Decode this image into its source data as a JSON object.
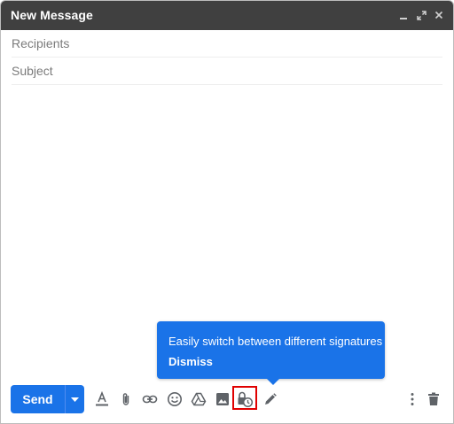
{
  "window": {
    "title": "New Message",
    "controls": {
      "minimize": "minimize-icon",
      "popout": "expand-icon",
      "close": "close-icon"
    }
  },
  "fields": {
    "recipients_placeholder": "Recipients",
    "recipients_value": "",
    "subject_placeholder": "Subject",
    "subject_value": ""
  },
  "toolbar": {
    "send_label": "Send",
    "icons": [
      "formatting-icon",
      "attach-icon",
      "link-icon",
      "emoji-icon",
      "drive-icon",
      "photo-icon",
      "confidential-mode-icon",
      "signature-icon",
      "more-options-icon",
      "trash-icon"
    ]
  },
  "tooltip": {
    "message": "Easily switch between different signatures",
    "dismiss_label": "Dismiss"
  },
  "colors": {
    "titlebar": "#404040",
    "accent": "#1a73e8",
    "highlight": "#e00000",
    "icon": "#5f6368"
  }
}
